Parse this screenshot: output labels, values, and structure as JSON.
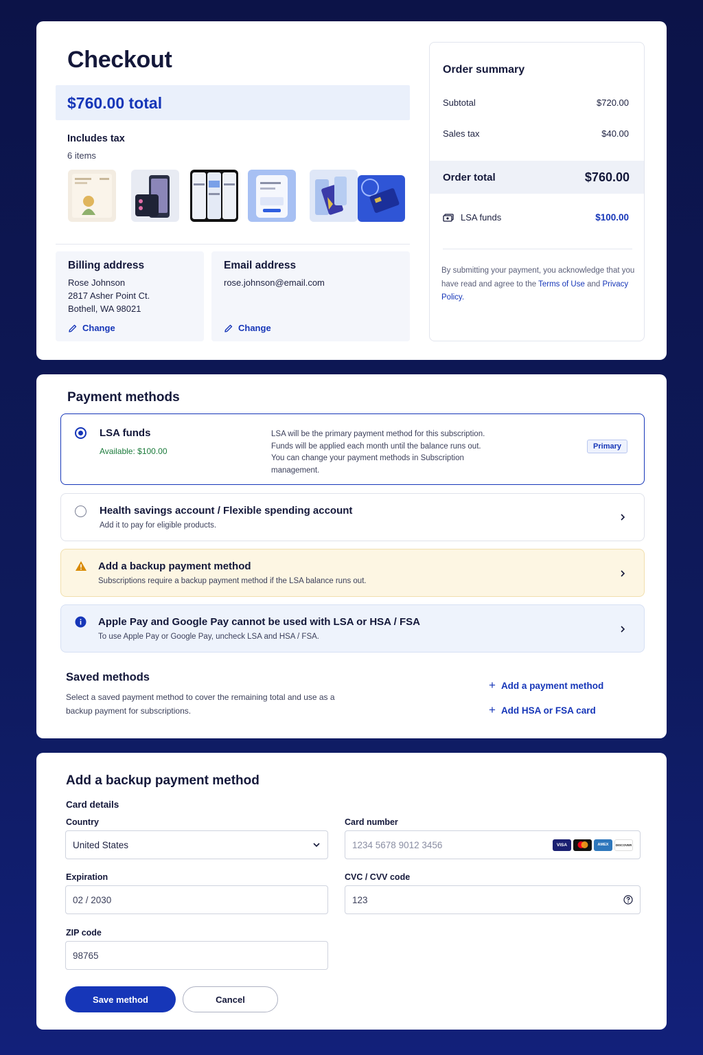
{
  "checkout": {
    "title": "Checkout",
    "total_label": "$760.00 total",
    "includes_tax": "Includes tax",
    "item_count": "6 items",
    "thumbnails": [
      "product-thumb-1",
      "product-thumb-2",
      "product-thumb-3",
      "product-thumb-4",
      "product-thumb-5",
      "product-thumb-6"
    ]
  },
  "billing": {
    "heading": "Billing address",
    "name": "Rose Johnson",
    "street": "2817 Asher Point Ct.",
    "city": "Bothell, WA 98021",
    "change_label": "Change"
  },
  "email": {
    "heading": "Email address",
    "value": "rose.johnson@email.com",
    "change_label": "Change"
  },
  "summary": {
    "heading": "Order summary",
    "subtotal_label": "Subtotal",
    "subtotal_value": "$720.00",
    "tax_label": "Sales tax",
    "tax_value": "$40.00",
    "total_label": "Order total",
    "total_value": "$760.00",
    "lsa_label": "LSA funds",
    "lsa_value": "$100.00",
    "fine_print_1": "By submitting your payment, you acknowledge that you have read and agree to the",
    "terms_link": "Terms of Use",
    "fine_print_2": "and",
    "privacy_link": "Privacy Policy."
  },
  "payment_methods": {
    "heading": "Payment methods",
    "lsa": {
      "title": "LSA funds",
      "available": "Available: $100.00",
      "desc_1": "LSA will be the primary payment method for this subscription.",
      "desc_2": "Funds will be applied each month until the balance runs out.",
      "desc_3": "You can change your payment methods in Subscription",
      "desc_4": "management.",
      "badge": "Primary"
    },
    "hsa": {
      "title": "Health savings account / Flexible spending account",
      "sub": "Add it to pay for eligible products."
    },
    "backup_warning": {
      "title": "Add a backup payment method",
      "sub": "Subscriptions require a backup payment method if the LSA balance runs out."
    },
    "wallet_info": {
      "title": "Apple Pay and Google Pay cannot be used with LSA or HSA / FSA",
      "sub": "To use Apple Pay or Google Pay, uncheck LSA and HSA / FSA."
    },
    "saved": {
      "heading": "Saved methods",
      "desc_1": "Select a saved payment method to cover the remaining total and use as a",
      "desc_2": "backup payment for subscriptions.",
      "add_payment": "Add a payment method",
      "add_hsa": "Add HSA or FSA card"
    }
  },
  "backup_form": {
    "heading": "Add a backup payment method",
    "card_details": "Card details",
    "country_label": "Country",
    "country_value": "United States",
    "card_label": "Card number",
    "card_placeholder": "1234 5678 9012 3456",
    "expiration_label": "Expiration",
    "expiration_value": "02 / 2030",
    "cvc_label": "CVC / CVV code",
    "cvc_value": "123",
    "zip_label": "ZIP code",
    "zip_value": "98765",
    "save_label": "Save method",
    "cancel_label": "Cancel",
    "card_brands": {
      "visa": "VISA",
      "amex": "AMEX",
      "discover": "DISCOVER"
    }
  },
  "colors": {
    "accent": "#1636b8",
    "background": "#0c1348",
    "success": "#1a7a3a",
    "warning_bg": "#fdf6e3",
    "warning_icon": "#d98a00",
    "info_bg": "#eef3fc"
  }
}
